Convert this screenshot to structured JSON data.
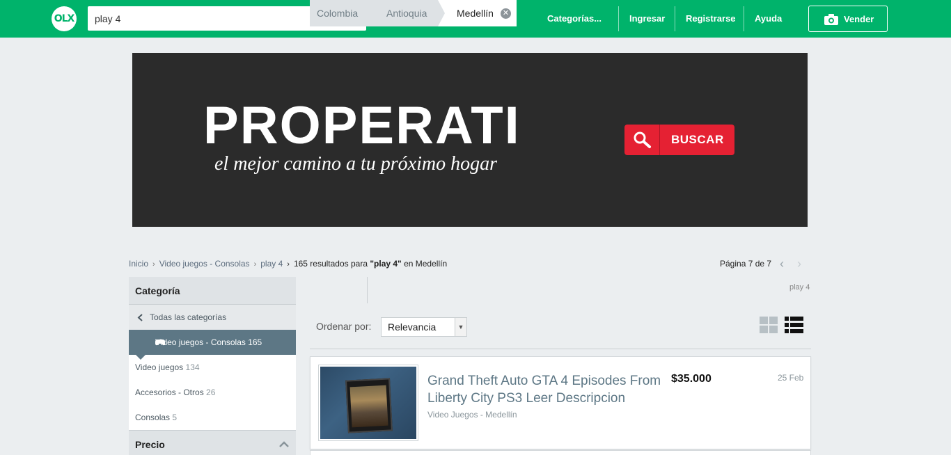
{
  "header": {
    "logo": "OLX",
    "search": {
      "value": "play 4"
    },
    "nav": [
      "Categorías...",
      "Ingresar",
      "Registrarse",
      "Ayuda"
    ],
    "sell_label": "Vender",
    "colors": {
      "brand": "#00b36b"
    }
  },
  "banner": {
    "title": "PROPERATI",
    "subtitle": "el mejor camino a tu próximo hogar",
    "button_label": "BUSCAR",
    "colors": {
      "background": "#2b2b2b",
      "button": "#e52133"
    }
  },
  "breadcrumb": {
    "items": [
      "Inicio",
      "Video juegos - Consolas",
      "play 4"
    ],
    "results_prefix": "165 resultados para ",
    "results_query": "\"play 4\"",
    "results_suffix": " en Medellín"
  },
  "pagination": {
    "label": "Página 7 de 7"
  },
  "sidebar": {
    "category_heading": "Categoría",
    "back_label": "Todas las categorías",
    "active": {
      "label": "Video juegos - Consolas 165",
      "icon": "gamepad-icon"
    },
    "items": [
      {
        "label": "Video juegos",
        "count": "134"
      },
      {
        "label": "Accesorios - Otros",
        "count": "26"
      },
      {
        "label": "Consolas",
        "count": "5"
      }
    ],
    "price_heading": "Precio"
  },
  "location_tabs": [
    "Colombia",
    "Antioquia",
    "Medellín"
  ],
  "query_tag": "play 4",
  "order": {
    "label": "Ordenar por:",
    "selected": "Relevancia"
  },
  "listings": [
    {
      "title": "Grand Theft Auto GTA 4 Episodes From Liberty City PS3 Leer Descripcion",
      "price": "$35.000",
      "subtitle": "Video Juegos - Medellín",
      "date": "25 Feb"
    }
  ]
}
